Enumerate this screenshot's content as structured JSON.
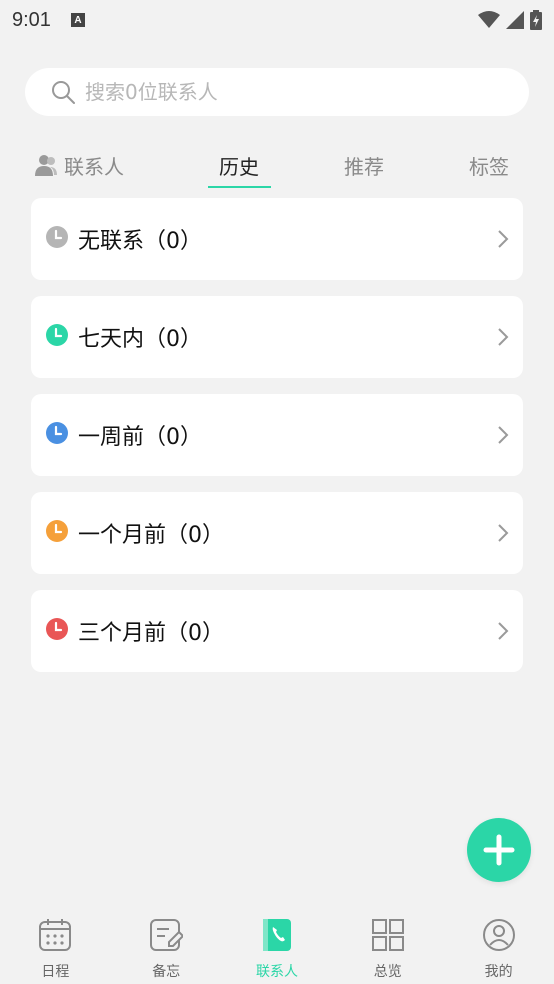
{
  "status_bar": {
    "time": "9:01",
    "notification_badge": "A"
  },
  "search": {
    "placeholder": "搜索0位联系人",
    "value": ""
  },
  "tabs": [
    {
      "label": "联系人",
      "icon": "person-icon",
      "active": false
    },
    {
      "label": "历史",
      "active": true
    },
    {
      "label": "推荐",
      "active": false
    },
    {
      "label": "标签",
      "active": false
    }
  ],
  "history_groups": [
    {
      "label": "无联系（0）",
      "icon_color": "#b5b5b5"
    },
    {
      "label": "七天内（0）",
      "icon_color": "#2bd6a7"
    },
    {
      "label": "一周前（0）",
      "icon_color": "#4a90e2"
    },
    {
      "label": "一个月前（0）",
      "icon_color": "#f5a03a"
    },
    {
      "label": "三个月前（0）",
      "icon_color": "#e95656"
    }
  ],
  "bottom_nav": [
    {
      "label": "日程",
      "icon": "calendar-icon",
      "active": false
    },
    {
      "label": "备忘",
      "icon": "memo-icon",
      "active": false
    },
    {
      "label": "联系人",
      "icon": "contacts-icon",
      "active": true
    },
    {
      "label": "总览",
      "icon": "grid-icon",
      "active": false
    },
    {
      "label": "我的",
      "icon": "profile-icon",
      "active": false
    }
  ],
  "colors": {
    "accent": "#2bd6a7",
    "background": "#f2f2f2"
  }
}
